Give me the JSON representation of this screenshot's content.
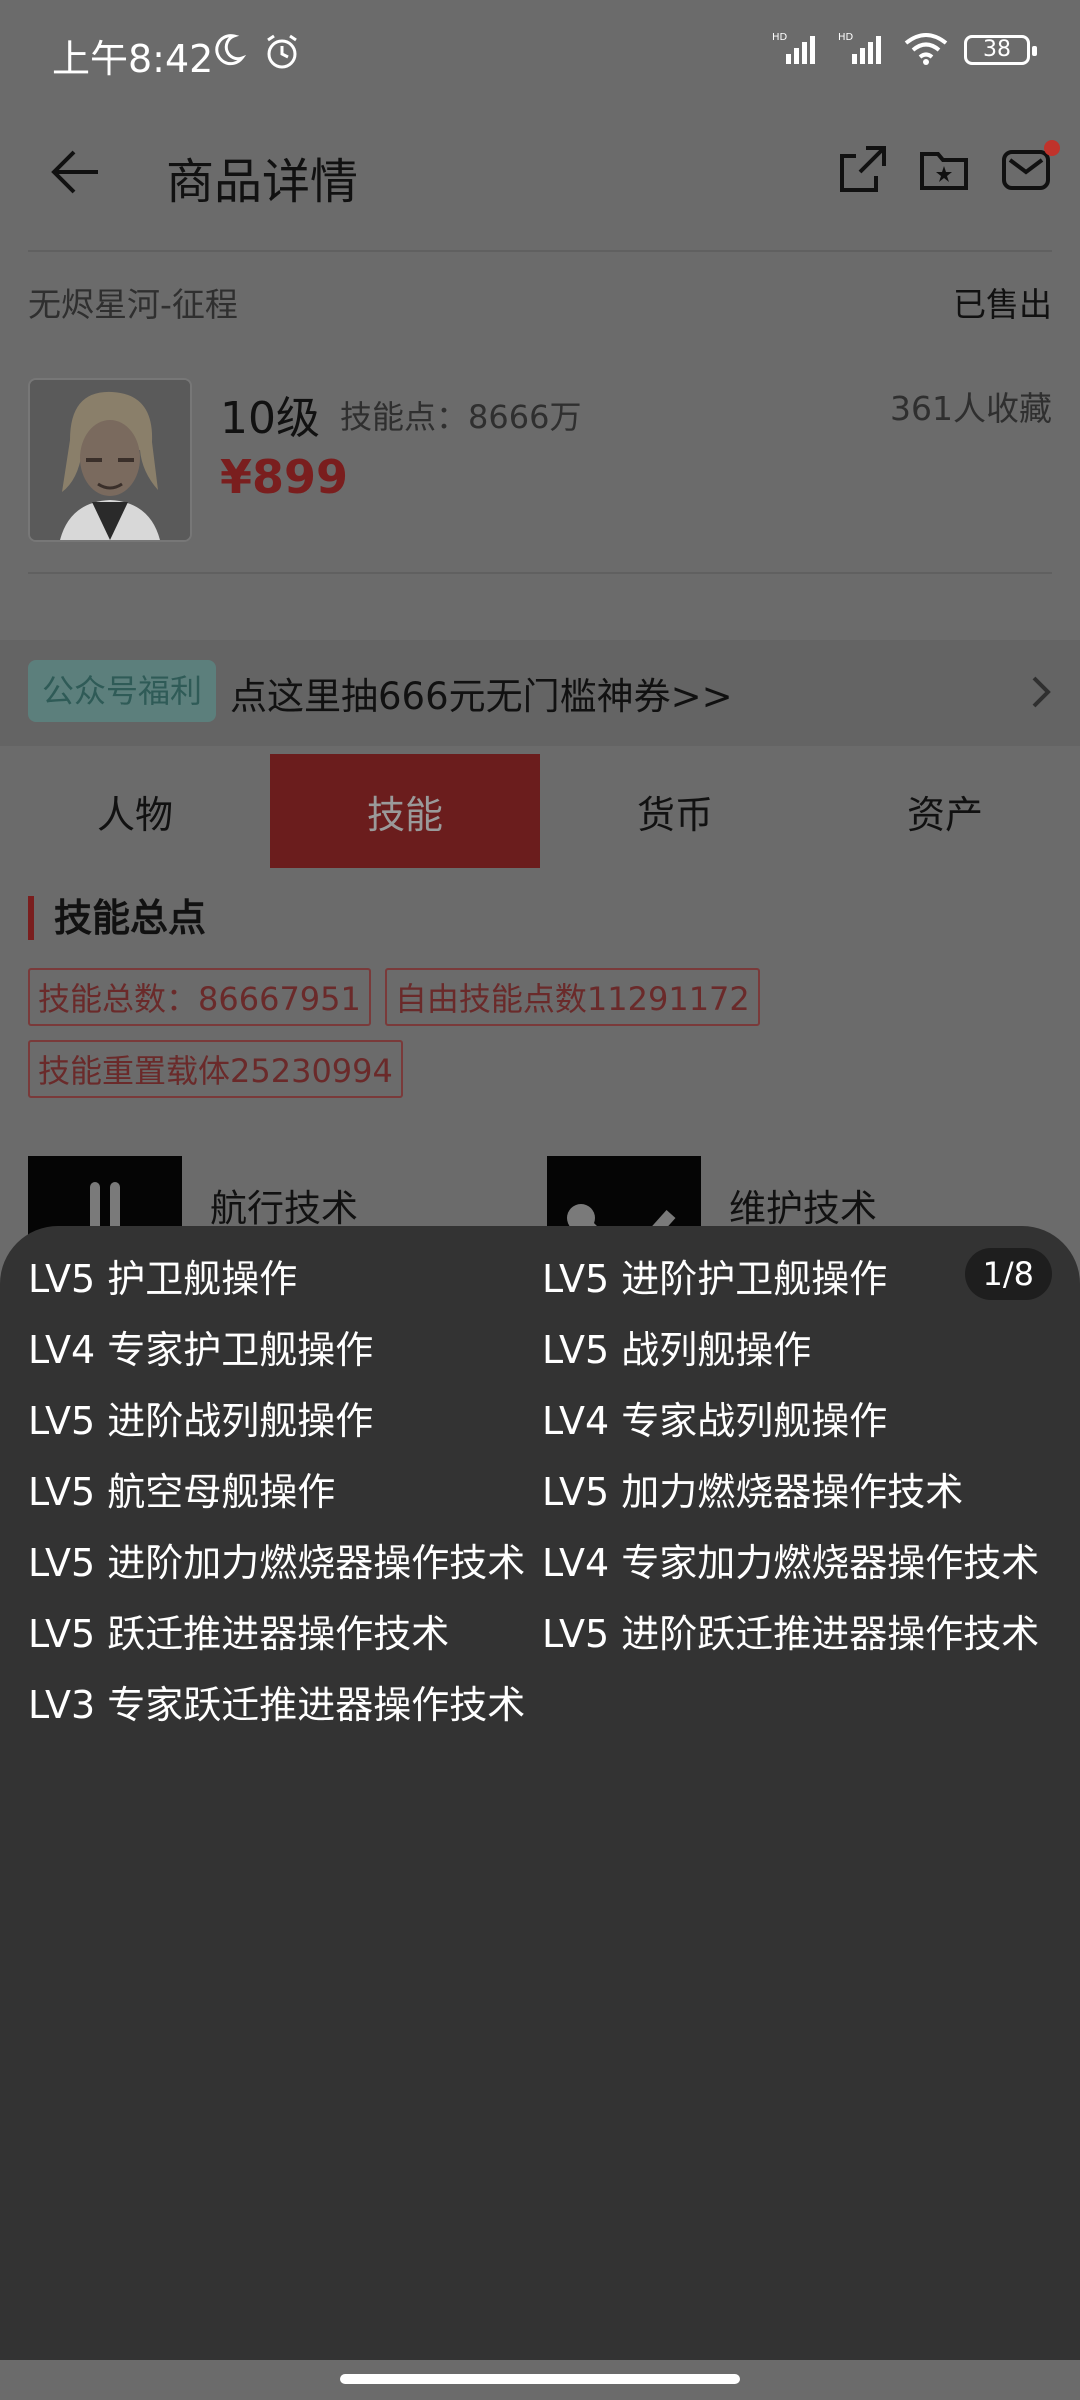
{
  "status_bar": {
    "time": "上午8:42",
    "battery": "38"
  },
  "header": {
    "title": "商品详情"
  },
  "game": {
    "name": "无烬星河-征程",
    "status": "已售出"
  },
  "product": {
    "level": "10级",
    "skill_points": "技能点：8666万",
    "price": "¥899",
    "favorites": "361人收藏"
  },
  "promo": {
    "tag": "公众号福利",
    "text": "点这里抽666元无门槛神券>>"
  },
  "tabs": [
    {
      "label": "人物"
    },
    {
      "label": "技能"
    },
    {
      "label": "货币"
    },
    {
      "label": "资产"
    }
  ],
  "section": {
    "title": "技能总点",
    "chips": [
      "技能总数：86667951",
      "自由技能点数11291172",
      "技能重置载体25230994"
    ]
  },
  "categories": [
    {
      "label": "航行技术",
      "icon": "navigation-icon"
    },
    {
      "label": "维护技术",
      "icon": "wrench-screwdriver-icon"
    }
  ],
  "panel": {
    "pager": "1/8",
    "skills": [
      "LV5 护卫舰操作",
      "LV5 进阶护卫舰操作",
      "LV4 专家护卫舰操作",
      "LV5 战列舰操作",
      "LV5 进阶战列舰操作",
      "LV4 专家战列舰操作",
      "LV5 航空母舰操作",
      "LV5 加力燃烧器操作技术",
      "LV5 进阶加力燃烧器操作技术",
      "LV4 专家加力燃烧器操作技术",
      "LV5 跃迁推进器操作技术",
      "LV5 进阶跃迁推进器操作技术",
      "LV3 专家跃迁推进器操作技术"
    ]
  },
  "colors": {
    "accent": "#7a1e1e",
    "overlay": "#333333"
  }
}
